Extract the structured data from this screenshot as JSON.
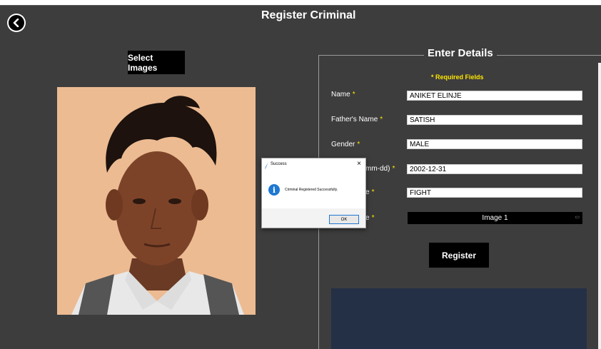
{
  "window": {
    "title": "Register Criminal"
  },
  "left": {
    "select_images_label": "Select Images"
  },
  "details": {
    "heading": "Enter Details",
    "required_note": "* Required Fields",
    "required_star": "*",
    "fields": [
      {
        "label": "Name",
        "value": "ANIKET ELINJE"
      },
      {
        "label": "Father's Name",
        "value": "SATISH"
      },
      {
        "label": "Gender",
        "value": "MALE"
      },
      {
        "label": "mm-dd)",
        "value": "2002-12-31"
      },
      {
        "label": "e",
        "value": "FIGHT"
      },
      {
        "label": "e",
        "value": ""
      }
    ],
    "image_select": {
      "selected": "Image 1"
    },
    "register_label": "Register"
  },
  "dialog": {
    "title": "Success",
    "message": "Criminal Registered Successfully.",
    "ok_label": "OK",
    "close_glyph": "×",
    "info_glyph": "i"
  },
  "icons": {
    "back": "back-arrow-icon",
    "info": "info-icon",
    "feather": "feather-icon",
    "close": "close-icon",
    "dropdown": "dropdown-arrow-icon"
  },
  "colors": {
    "background": "#3d3d3d",
    "required": "#ffe600",
    "info_blue": "#1f78d1",
    "bottom_panel": "#243046"
  }
}
